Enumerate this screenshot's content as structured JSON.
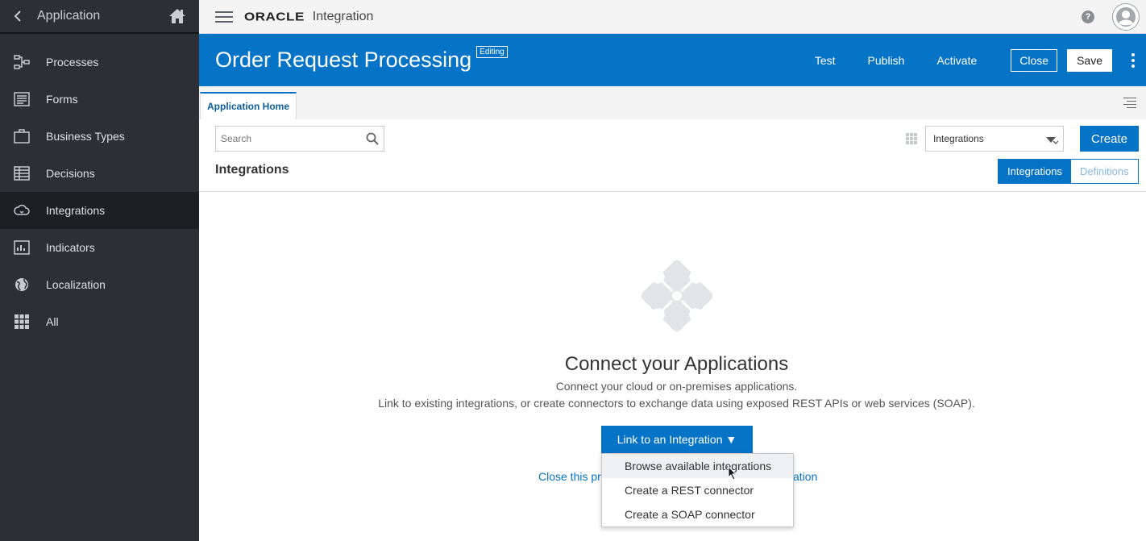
{
  "sidebar": {
    "title": "Application",
    "items": [
      {
        "label": "Processes",
        "icon": "processes-icon"
      },
      {
        "label": "Forms",
        "icon": "forms-icon"
      },
      {
        "label": "Business Types",
        "icon": "briefcase-icon"
      },
      {
        "label": "Decisions",
        "icon": "decision-table-icon"
      },
      {
        "label": "Integrations",
        "icon": "cloud-icon",
        "active": true
      },
      {
        "label": "Indicators",
        "icon": "chart-icon"
      },
      {
        "label": "Localization",
        "icon": "globe-icon"
      },
      {
        "label": "All",
        "icon": "apps-grid-icon"
      }
    ]
  },
  "topbar": {
    "brand": "ORACLE",
    "product": "Integration"
  },
  "header": {
    "title": "Order Request Processing",
    "badge": "Editing",
    "actions": {
      "test": "Test",
      "publish": "Publish",
      "activate": "Activate",
      "close": "Close",
      "save": "Save"
    }
  },
  "tabs": [
    {
      "label": "Application Home"
    }
  ],
  "toolbar": {
    "search_placeholder": "Search",
    "filter_value": "Integrations",
    "create_label": "Create",
    "section_title": "Integrations",
    "segments": [
      "Integrations",
      "Definitions"
    ]
  },
  "empty_state": {
    "title": "Connect your Applications",
    "line1": "Connect your cloud or on-premises applications.",
    "line2": "Link to existing integrations, or create connectors to exchange data using exposed REST APIs or web services (SOAP).",
    "button": "Link to an Integration ▼",
    "close_link_left": "Close this pr",
    "close_link_right": "ation"
  },
  "dropdown": {
    "items": [
      "Browse available integrations",
      "Create a REST connector",
      "Create a SOAP connector"
    ]
  },
  "colors": {
    "accent": "#0573c6",
    "sidebar_bg": "#2b3034",
    "sidebar_active": "#1d2023"
  }
}
